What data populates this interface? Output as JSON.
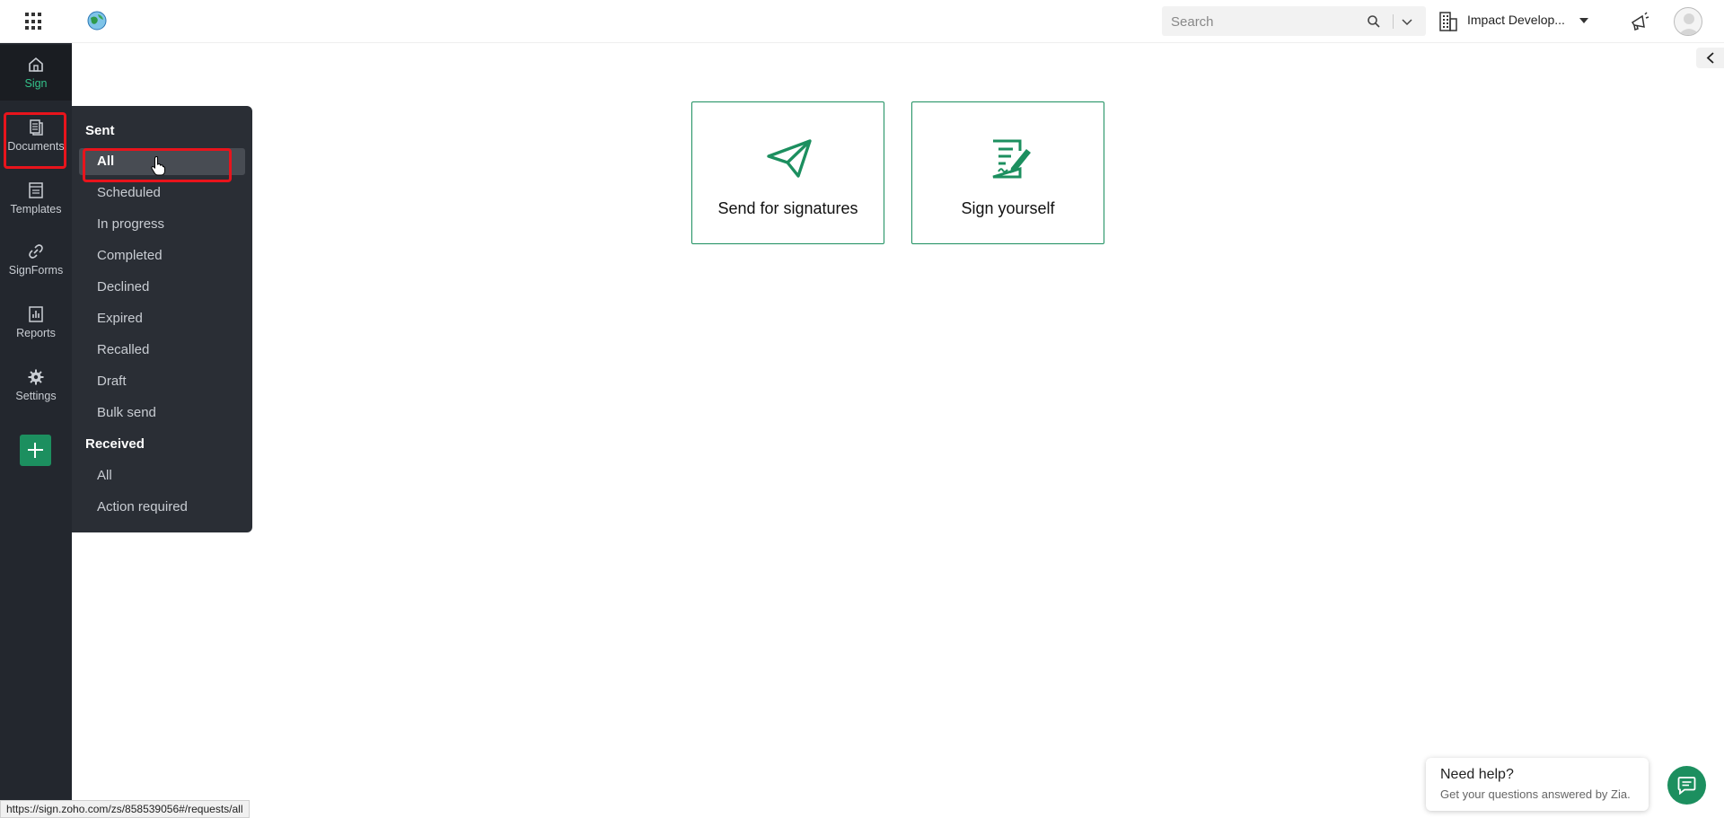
{
  "topbar": {
    "search_placeholder": "Search",
    "org_name": "Impact Develop..."
  },
  "sidebar": {
    "items": [
      {
        "label": "Sign",
        "icon": "home-icon"
      },
      {
        "label": "Documents",
        "icon": "documents-icon"
      },
      {
        "label": "Templates",
        "icon": "templates-icon"
      },
      {
        "label": "SignForms",
        "icon": "link-icon"
      },
      {
        "label": "Reports",
        "icon": "reports-icon"
      },
      {
        "label": "Settings",
        "icon": "gear-icon"
      }
    ]
  },
  "flyout": {
    "sent_heading": "Sent",
    "sent_items": [
      "All",
      "Scheduled",
      "In progress",
      "Completed",
      "Declined",
      "Expired",
      "Recalled",
      "Draft",
      "Bulk send"
    ],
    "received_heading": "Received",
    "received_items": [
      "All",
      "Action required"
    ]
  },
  "cards": {
    "send_label": "Send for signatures",
    "self_label": "Sign yourself"
  },
  "help": {
    "title": "Need help?",
    "subtitle": "Get your questions answered by Zia."
  },
  "status_url": "https://sign.zoho.com/zs/858539056#/requests/all",
  "colors": {
    "accent": "#1c8f5f",
    "sidebar_bg": "#23272e",
    "flyout_bg": "#2a2e35",
    "highlight": "#e8141c"
  }
}
